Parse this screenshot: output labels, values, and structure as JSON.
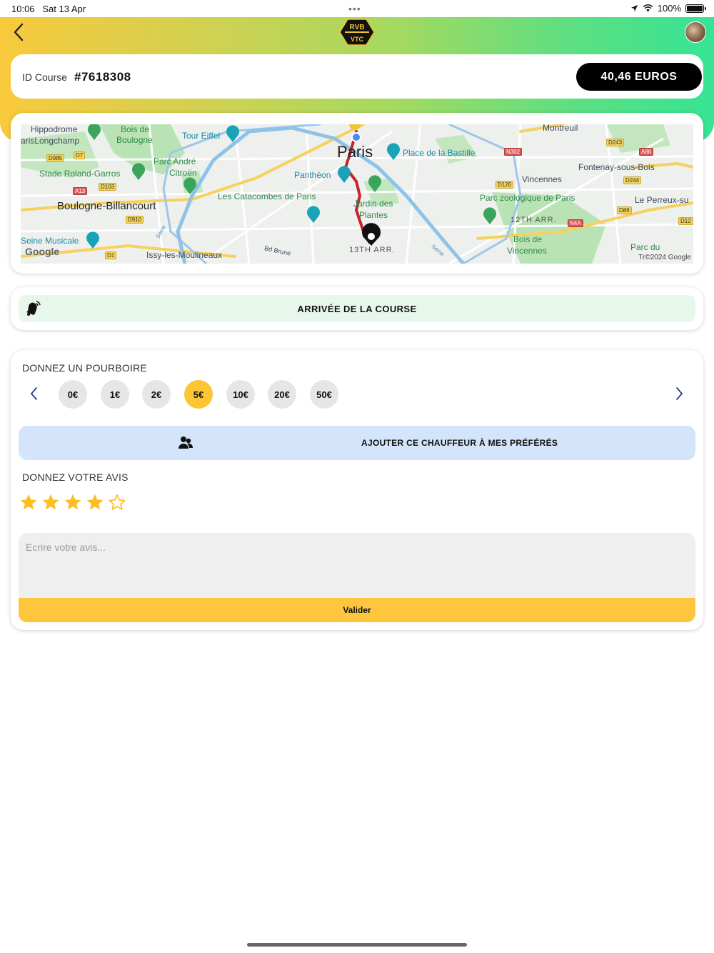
{
  "status_bar": {
    "time": "10:06",
    "date": "Sat 13 Apr",
    "battery": "100%"
  },
  "header": {
    "logo_top": "RVB",
    "logo_bottom": "VTC",
    "logo_icon": "rvb-vtc-logo",
    "back_icon": "chevron-left-icon",
    "avatar_icon": "user-avatar"
  },
  "course": {
    "id_label": "ID Course",
    "id_value": "#7618308",
    "price": "40,46 EUROS"
  },
  "map": {
    "places": {
      "hippodrome": "Hippodrome",
      "longchamp": "arisLongchamp",
      "bois_boulogne_1": "Bois de",
      "bois_boulogne_2": "Boulogne",
      "tour_eiffel": "Tour Eiffel",
      "parc_andre_1": "Parc André",
      "parc_andre_2": "Citroën",
      "stade": "Stade Roland-Garros",
      "boulogne": "Boulogne-Billancourt",
      "catacombes": "Les Catacombes de Paris",
      "seine_musicale": "Seine Musicale",
      "issy": "Issy-les-Moulineaux",
      "bd_brune": "Bd Brune",
      "paris": "Paris",
      "pantheon": "Panthéon",
      "place_bastille": "Place de la Bastille",
      "jardin_1": "Jardin des",
      "jardin_2": "Plantes",
      "arr13": "13TH ARR.",
      "montreuil": "Montreuil",
      "fontenay": "Fontenay-sous-Bois",
      "vincennes": "Vincennes",
      "parc_zoo": "Parc zoologique de Paris",
      "arr12": "12TH ARR.",
      "bois_vincennes_1": "Bois de",
      "bois_vincennes_2": "Vincennes",
      "perreux": "Le Perreux-su",
      "parc_du": "Parc du",
      "seine_1": "Seine",
      "seine_2": "Seine"
    },
    "roads": {
      "d985": "D985",
      "d7": "D7",
      "a13": "A13",
      "d103": "D103",
      "d910": "D910",
      "d1": "D1",
      "n302": "N302",
      "d243": "D243",
      "a86": "A86",
      "d120": "D120",
      "d244": "D244",
      "d86": "D86",
      "n4a": "N4A",
      "d12": "D12"
    },
    "google": "Google",
    "copyright": "Tr©2024 Google",
    "colors": {
      "route": "#c8232c",
      "water": "#8ec3e8",
      "park": "#b9e2b5",
      "highway": "#f6d15f"
    }
  },
  "arrival": {
    "label": "ARRIVÉE DE LA COURSE",
    "icon": "bell-ringing-icon"
  },
  "tip": {
    "title": "DONNEZ UN POURBOIRE",
    "options": [
      "0€",
      "1€",
      "2€",
      "5€",
      "10€",
      "20€",
      "50€"
    ],
    "selected": "5€"
  },
  "favorite": {
    "label": "AJOUTER CE CHAUFFEUR À MES PRÉFÉRÉS",
    "icon": "users-icon"
  },
  "review": {
    "title": "DONNEZ VOTRE AVIS",
    "rating": 4,
    "max_rating": 5,
    "placeholder": "Ecrire votre avis...",
    "value": "",
    "submit": "Valider"
  },
  "colors": {
    "accent": "#fdc531",
    "favorite_bg": "#d3e4fb",
    "arrival_bg": "#e8f7ec",
    "price_bg": "#000000"
  }
}
